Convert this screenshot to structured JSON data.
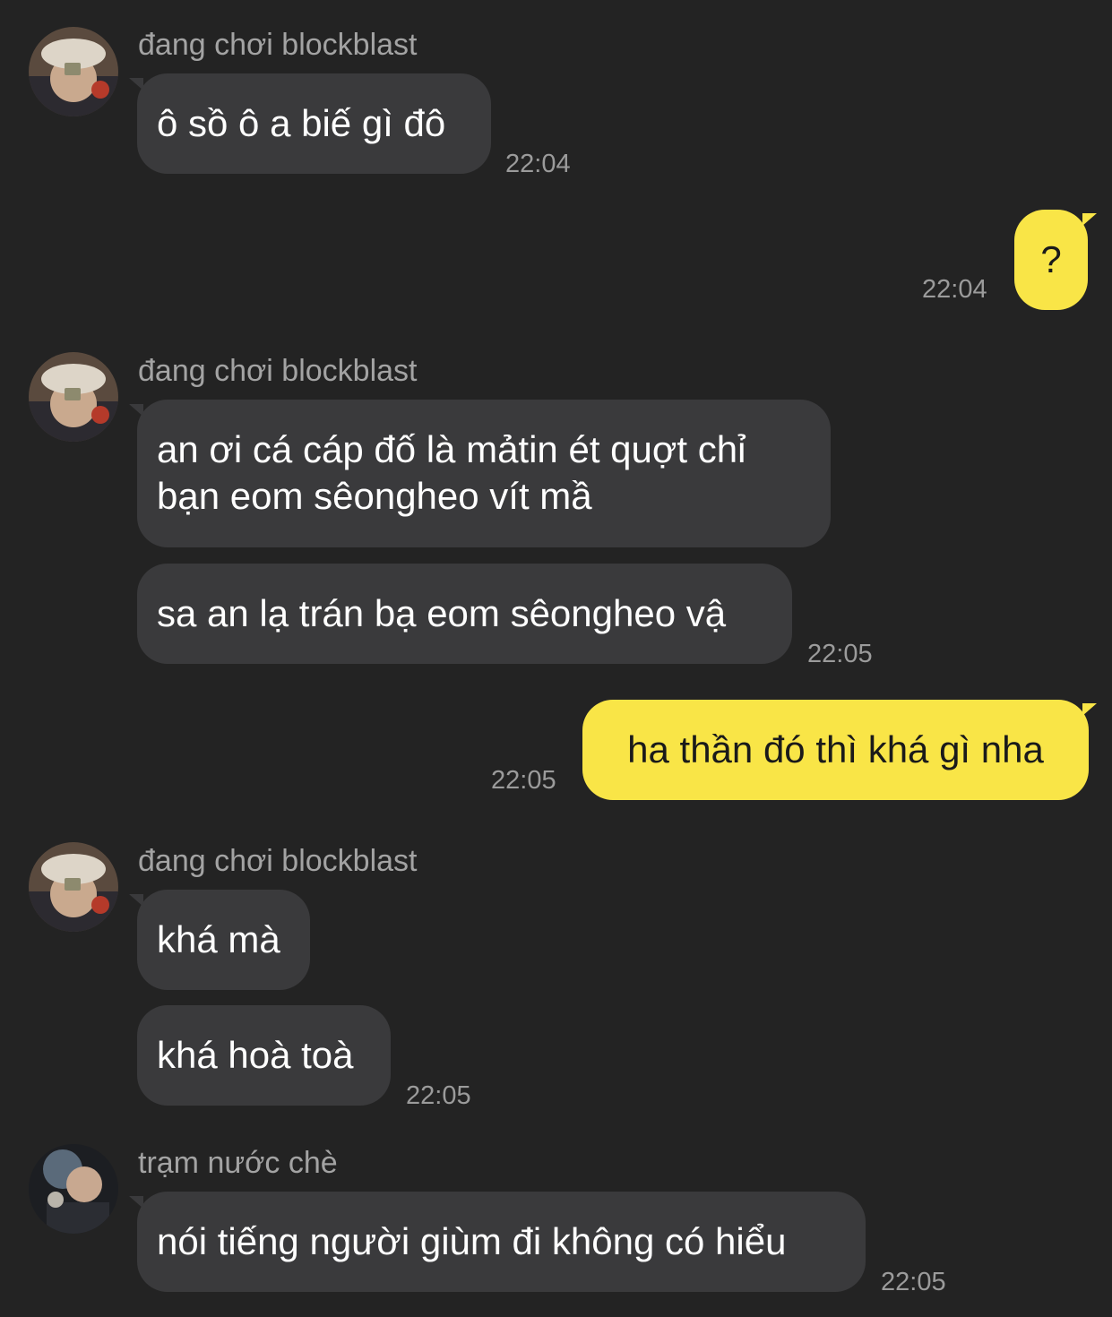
{
  "colors": {
    "background": "#232323",
    "incoming_bubble": "#3a3a3c",
    "outgoing_bubble": "#f9e547",
    "sender_name": "#a3a3a3",
    "timestamp": "#9b9b9b"
  },
  "messages": [
    {
      "direction": "incoming",
      "sender": "đang chơi blockblast",
      "avatar_icon": "user-avatar-cap-icon",
      "bubbles": [
        "ô sồ ô a biế gì đô"
      ],
      "time": "22:04"
    },
    {
      "direction": "outgoing",
      "bubbles": [
        "?"
      ],
      "time": "22:04"
    },
    {
      "direction": "incoming",
      "sender": "đang chơi blockblast",
      "avatar_icon": "user-avatar-cap-icon",
      "bubbles": [
        "an ơi cá cáp đố là mảtin ét quợt chỉ\nbạn eom sêongheo vít mầ",
        "sa an lạ trán bạ eom sêongheo vậ"
      ],
      "time": "22:05"
    },
    {
      "direction": "outgoing",
      "bubbles": [
        "ha thần đó thì khá gì nha"
      ],
      "time": "22:05"
    },
    {
      "direction": "incoming",
      "sender": "đang chơi blockblast",
      "avatar_icon": "user-avatar-cap-icon",
      "bubbles": [
        "khá mà",
        "khá hoà toà"
      ],
      "time": "22:05"
    },
    {
      "direction": "incoming",
      "sender": "trạm nước chè",
      "avatar_icon": "user-avatar-dark-icon",
      "bubbles": [
        "nói tiếng người giùm đi không có hiểu"
      ],
      "time": "22:05"
    }
  ]
}
